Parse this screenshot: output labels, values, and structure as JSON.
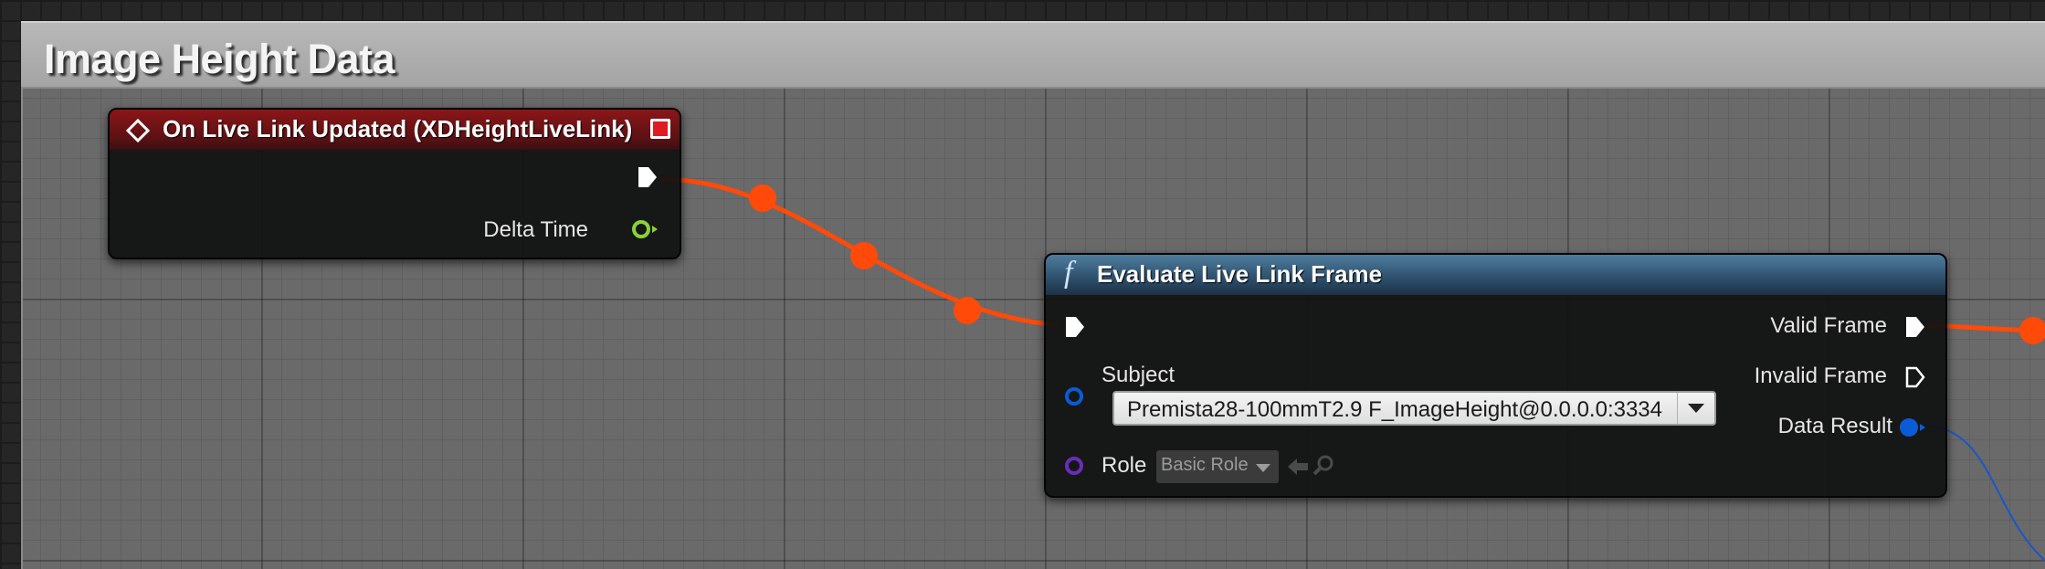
{
  "comment": {
    "title": "Image Height Data"
  },
  "event_node": {
    "title": "On Live Link Updated (XDHeightLiveLink)",
    "outputs": {
      "delta_time": "Delta Time"
    }
  },
  "function_node": {
    "title": "Evaluate Live Link Frame",
    "icon": "f",
    "inputs": {
      "subject_label": "Subject",
      "subject_value": "Premista28-100mmT2.9 F_ImageHeight@0.0.0.0:3334",
      "role_label": "Role",
      "role_value": "Basic Role"
    },
    "outputs": {
      "valid_frame": "Valid Frame",
      "invalid_frame": "Invalid Frame",
      "data_result": "Data Result"
    }
  },
  "colors": {
    "exec_wire": "#ff4a0a",
    "event_header": "#8b1618",
    "function_header": "#4f7d9e",
    "float_pin": "#8bd13a",
    "struct_pin": "#0b5bd6",
    "object_pin": "#6a2db8"
  },
  "icons": [
    "event-diamond-icon",
    "stop-icon",
    "function-icon",
    "dropdown-arrow-icon",
    "browse-arrow-icon",
    "search-icon",
    "exec-pin-icon"
  ]
}
